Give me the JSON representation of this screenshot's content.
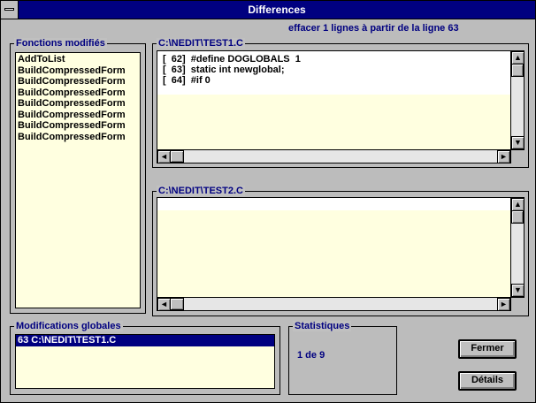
{
  "window": {
    "title": "Differences"
  },
  "header": {
    "message": "effacer 1 lignes à partir de la ligne 63"
  },
  "functions": {
    "label": "Fonctions modifiés",
    "items": [
      "AddToList",
      "BuildCompressedForm",
      "BuildCompressedForm",
      "BuildCompressedForm",
      "BuildCompressedForm",
      "BuildCompressedForm",
      "BuildCompressedForm",
      "BuildCompressedForm"
    ]
  },
  "file1": {
    "label": "C:\\NEDIT\\TEST1.C",
    "lines": [
      "[  62]  #define DOGLOBALS  1",
      "[  63]  static int newglobal;",
      "[  64]  #if 0"
    ]
  },
  "file2": {
    "label": "C:\\NEDIT\\TEST2.C",
    "lines": []
  },
  "global_mods": {
    "label": "Modifications globales",
    "items": [
      "63 C:\\NEDIT\\TEST1.C"
    ],
    "selected_index": 0
  },
  "stats": {
    "label": "Statistiques",
    "value": "1 de 9"
  },
  "buttons": {
    "close": "Fermer",
    "details": "Détails"
  },
  "scroll_glyphs": {
    "up": "▲",
    "down": "▼",
    "left": "◄",
    "right": "►"
  },
  "colors": {
    "titlebar": "#000080",
    "list_bg": "#ffffe0",
    "label_text": "#000080"
  }
}
